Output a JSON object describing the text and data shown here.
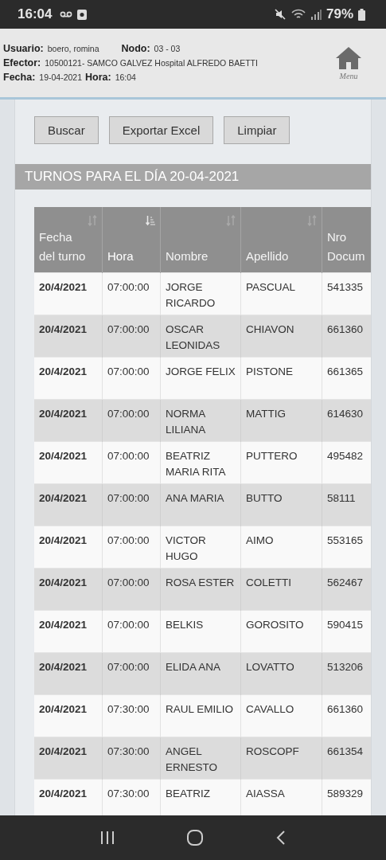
{
  "status_bar": {
    "time": "16:04",
    "battery": "79%"
  },
  "header": {
    "fields": [
      {
        "label": "Usuario:",
        "value": "boero, romina"
      },
      {
        "label": "Nodo:",
        "value": "03 - 03"
      },
      {
        "label": "Efector:",
        "value": "10500121- SAMCO GALVEZ Hospital ALFREDO BAETTI"
      },
      {
        "label": "Fecha:",
        "value": "19-04-2021"
      },
      {
        "label": "Hora:",
        "value": "16:04"
      }
    ],
    "menu_label": "Menu"
  },
  "buttons": [
    "Buscar",
    "Exportar Excel",
    "Limpiar"
  ],
  "section_title": "TURNOS PARA EL DÍA 20-04-2021",
  "table": {
    "columns": [
      {
        "label": "Fecha del turno",
        "sortable": true,
        "sorted": false
      },
      {
        "label": "Hora",
        "sortable": true,
        "sorted": true
      },
      {
        "label": "Nombre",
        "sortable": true,
        "sorted": false
      },
      {
        "label": "Apellido",
        "sortable": true,
        "sorted": false
      },
      {
        "label": "Nro Docum",
        "sortable": false
      }
    ],
    "rows": [
      [
        "20/4/2021",
        "07:00:00",
        "JORGE RICARDO",
        "PASCUAL",
        "541335"
      ],
      [
        "20/4/2021",
        "07:00:00",
        "OSCAR LEONIDAS",
        "CHIAVON",
        "661360"
      ],
      [
        "20/4/2021",
        "07:00:00",
        "JORGE FELIX",
        "PISTONE",
        "661365"
      ],
      [
        "20/4/2021",
        "07:00:00",
        "NORMA LILIANA",
        "MATTIG",
        "614630"
      ],
      [
        "20/4/2021",
        "07:00:00",
        "BEATRIZ MARIA RITA",
        "PUTTERO",
        "495482"
      ],
      [
        "20/4/2021",
        "07:00:00",
        "ANA MARIA",
        "BUTTO",
        "58111"
      ],
      [
        "20/4/2021",
        "07:00:00",
        "VICTOR HUGO",
        "AIMO",
        "553165"
      ],
      [
        "20/4/2021",
        "07:00:00",
        "ROSA ESTER",
        "COLETTI",
        "562467"
      ],
      [
        "20/4/2021",
        "07:00:00",
        "BELKIS",
        "GOROSITO",
        "590415"
      ],
      [
        "20/4/2021",
        "07:00:00",
        "ELIDA ANA",
        "LOVATTO",
        "513206"
      ],
      [
        "20/4/2021",
        "07:30:00",
        "RAUL EMILIO",
        "CAVALLO",
        "661360"
      ],
      [
        "20/4/2021",
        "07:30:00",
        "ANGEL ERNESTO",
        "ROSCOPF",
        "661354"
      ],
      [
        "20/4/2021",
        "07:30:00",
        "BEATRIZ",
        "AIASSA",
        "589329"
      ]
    ]
  }
}
